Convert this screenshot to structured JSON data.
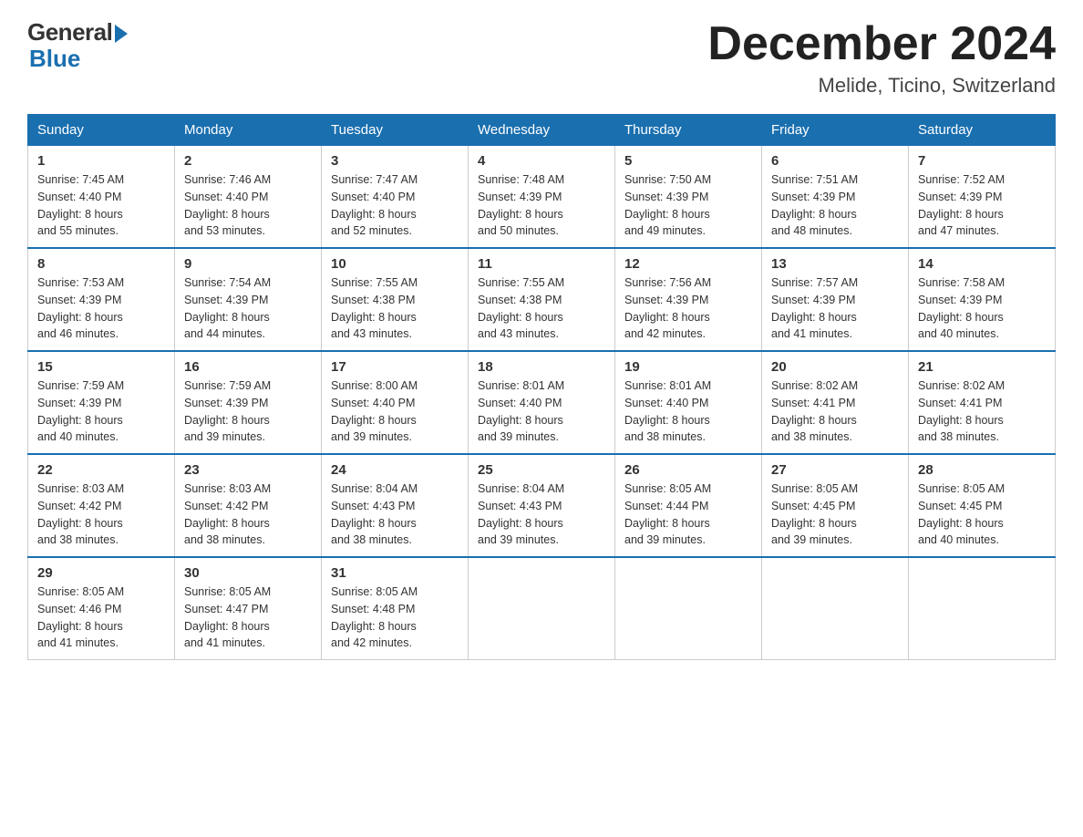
{
  "header": {
    "logo_general": "General",
    "logo_blue": "Blue",
    "month_title": "December 2024",
    "location": "Melide, Ticino, Switzerland"
  },
  "days_of_week": [
    "Sunday",
    "Monday",
    "Tuesday",
    "Wednesday",
    "Thursday",
    "Friday",
    "Saturday"
  ],
  "weeks": [
    [
      {
        "num": "1",
        "sunrise": "7:45 AM",
        "sunset": "4:40 PM",
        "daylight": "8 hours and 55 minutes."
      },
      {
        "num": "2",
        "sunrise": "7:46 AM",
        "sunset": "4:40 PM",
        "daylight": "8 hours and 53 minutes."
      },
      {
        "num": "3",
        "sunrise": "7:47 AM",
        "sunset": "4:40 PM",
        "daylight": "8 hours and 52 minutes."
      },
      {
        "num": "4",
        "sunrise": "7:48 AM",
        "sunset": "4:39 PM",
        "daylight": "8 hours and 50 minutes."
      },
      {
        "num": "5",
        "sunrise": "7:50 AM",
        "sunset": "4:39 PM",
        "daylight": "8 hours and 49 minutes."
      },
      {
        "num": "6",
        "sunrise": "7:51 AM",
        "sunset": "4:39 PM",
        "daylight": "8 hours and 48 minutes."
      },
      {
        "num": "7",
        "sunrise": "7:52 AM",
        "sunset": "4:39 PM",
        "daylight": "8 hours and 47 minutes."
      }
    ],
    [
      {
        "num": "8",
        "sunrise": "7:53 AM",
        "sunset": "4:39 PM",
        "daylight": "8 hours and 46 minutes."
      },
      {
        "num": "9",
        "sunrise": "7:54 AM",
        "sunset": "4:39 PM",
        "daylight": "8 hours and 44 minutes."
      },
      {
        "num": "10",
        "sunrise": "7:55 AM",
        "sunset": "4:38 PM",
        "daylight": "8 hours and 43 minutes."
      },
      {
        "num": "11",
        "sunrise": "7:55 AM",
        "sunset": "4:38 PM",
        "daylight": "8 hours and 43 minutes."
      },
      {
        "num": "12",
        "sunrise": "7:56 AM",
        "sunset": "4:39 PM",
        "daylight": "8 hours and 42 minutes."
      },
      {
        "num": "13",
        "sunrise": "7:57 AM",
        "sunset": "4:39 PM",
        "daylight": "8 hours and 41 minutes."
      },
      {
        "num": "14",
        "sunrise": "7:58 AM",
        "sunset": "4:39 PM",
        "daylight": "8 hours and 40 minutes."
      }
    ],
    [
      {
        "num": "15",
        "sunrise": "7:59 AM",
        "sunset": "4:39 PM",
        "daylight": "8 hours and 40 minutes."
      },
      {
        "num": "16",
        "sunrise": "7:59 AM",
        "sunset": "4:39 PM",
        "daylight": "8 hours and 39 minutes."
      },
      {
        "num": "17",
        "sunrise": "8:00 AM",
        "sunset": "4:40 PM",
        "daylight": "8 hours and 39 minutes."
      },
      {
        "num": "18",
        "sunrise": "8:01 AM",
        "sunset": "4:40 PM",
        "daylight": "8 hours and 39 minutes."
      },
      {
        "num": "19",
        "sunrise": "8:01 AM",
        "sunset": "4:40 PM",
        "daylight": "8 hours and 38 minutes."
      },
      {
        "num": "20",
        "sunrise": "8:02 AM",
        "sunset": "4:41 PM",
        "daylight": "8 hours and 38 minutes."
      },
      {
        "num": "21",
        "sunrise": "8:02 AM",
        "sunset": "4:41 PM",
        "daylight": "8 hours and 38 minutes."
      }
    ],
    [
      {
        "num": "22",
        "sunrise": "8:03 AM",
        "sunset": "4:42 PM",
        "daylight": "8 hours and 38 minutes."
      },
      {
        "num": "23",
        "sunrise": "8:03 AM",
        "sunset": "4:42 PM",
        "daylight": "8 hours and 38 minutes."
      },
      {
        "num": "24",
        "sunrise": "8:04 AM",
        "sunset": "4:43 PM",
        "daylight": "8 hours and 38 minutes."
      },
      {
        "num": "25",
        "sunrise": "8:04 AM",
        "sunset": "4:43 PM",
        "daylight": "8 hours and 39 minutes."
      },
      {
        "num": "26",
        "sunrise": "8:05 AM",
        "sunset": "4:44 PM",
        "daylight": "8 hours and 39 minutes."
      },
      {
        "num": "27",
        "sunrise": "8:05 AM",
        "sunset": "4:45 PM",
        "daylight": "8 hours and 39 minutes."
      },
      {
        "num": "28",
        "sunrise": "8:05 AM",
        "sunset": "4:45 PM",
        "daylight": "8 hours and 40 minutes."
      }
    ],
    [
      {
        "num": "29",
        "sunrise": "8:05 AM",
        "sunset": "4:46 PM",
        "daylight": "8 hours and 41 minutes."
      },
      {
        "num": "30",
        "sunrise": "8:05 AM",
        "sunset": "4:47 PM",
        "daylight": "8 hours and 41 minutes."
      },
      {
        "num": "31",
        "sunrise": "8:05 AM",
        "sunset": "4:48 PM",
        "daylight": "8 hours and 42 minutes."
      },
      null,
      null,
      null,
      null
    ]
  ],
  "labels": {
    "sunrise": "Sunrise:",
    "sunset": "Sunset:",
    "daylight": "Daylight:"
  }
}
